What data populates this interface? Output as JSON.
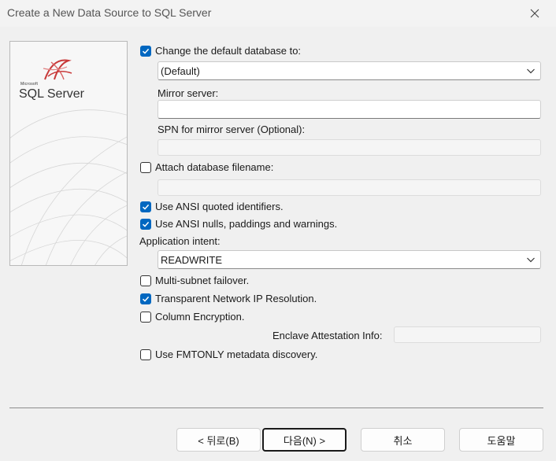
{
  "window": {
    "title": "Create a New Data Source to SQL Server"
  },
  "logo": {
    "small_text": "Microsoft",
    "text": "SQL Server"
  },
  "default_db": {
    "label": "Change the default database to:",
    "checked": true,
    "value": "(Default)"
  },
  "mirror": {
    "label": "Mirror server:",
    "value": ""
  },
  "spn": {
    "label": "SPN for mirror server (Optional):",
    "value": ""
  },
  "attach": {
    "label": "Attach database filename:",
    "checked": false,
    "value": ""
  },
  "ansi_quoted": {
    "label": "Use ANSI quoted identifiers.",
    "checked": true
  },
  "ansi_nulls": {
    "label": "Use ANSI nulls, paddings and warnings.",
    "checked": true
  },
  "app_intent": {
    "label": "Application intent:",
    "value": "READWRITE"
  },
  "multisubnet": {
    "label": "Multi-subnet failover.",
    "checked": false
  },
  "tnir": {
    "label": "Transparent Network IP Resolution.",
    "checked": true
  },
  "column_enc": {
    "label": "Column Encryption.",
    "checked": false
  },
  "enclave": {
    "label": "Enclave Attestation Info:",
    "value": ""
  },
  "fmtonly": {
    "label": "Use FMTONLY metadata discovery.",
    "checked": false
  },
  "buttons": {
    "back": "< 뒤로(B)",
    "next": "다음(N) >",
    "cancel": "취소",
    "help": "도움말"
  }
}
